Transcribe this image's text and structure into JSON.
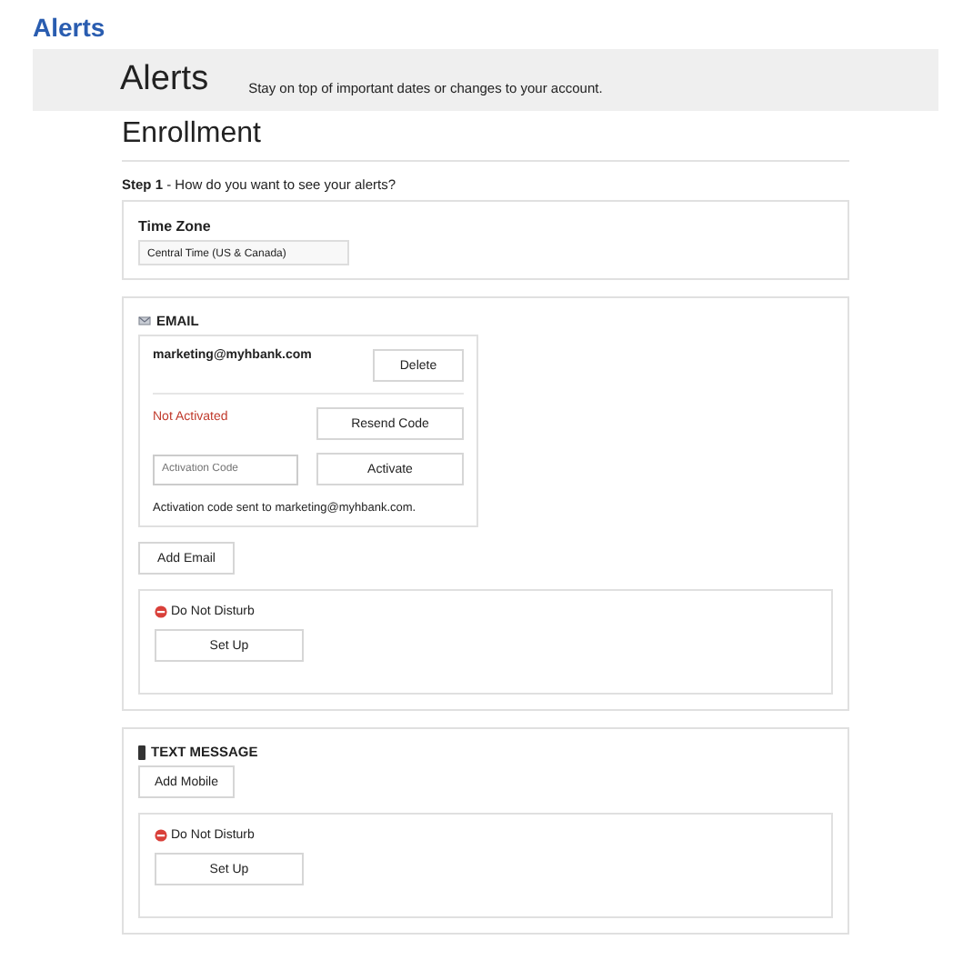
{
  "app_title": "Alerts",
  "banner": {
    "title": "Alerts",
    "subtitle": "Stay on top of important dates or changes to your account."
  },
  "heading": "Enrollment",
  "step": "**Step 1** - How do you want to see your alerts?",
  "time_zone": {
    "label": "Time Zone",
    "value": "Central Time (US & Canada)"
  },
  "channels": [
    {
      "kind": "email",
      "title": "EMAIL",
      "addresses": [
        {
          "address": "marketing@myhbank.com",
          "delete_button": "Delete",
          "status": "Not Activated",
          "resend_button": "Resend Code",
          "code_placeholder": "Activation Code",
          "activate_button": "Activate",
          "note": "Activation code sent to marketing@myhbank.com."
        }
      ],
      "add_button": "Add Email",
      "dnd": {
        "label": "Do Not Disturb",
        "button": "Set Up"
      }
    },
    {
      "kind": "sms",
      "title": "TEXT MESSAGE",
      "add_button": "Add Mobile",
      "dnd": {
        "label": "Do Not Disturb",
        "button": "Set Up"
      }
    }
  ]
}
